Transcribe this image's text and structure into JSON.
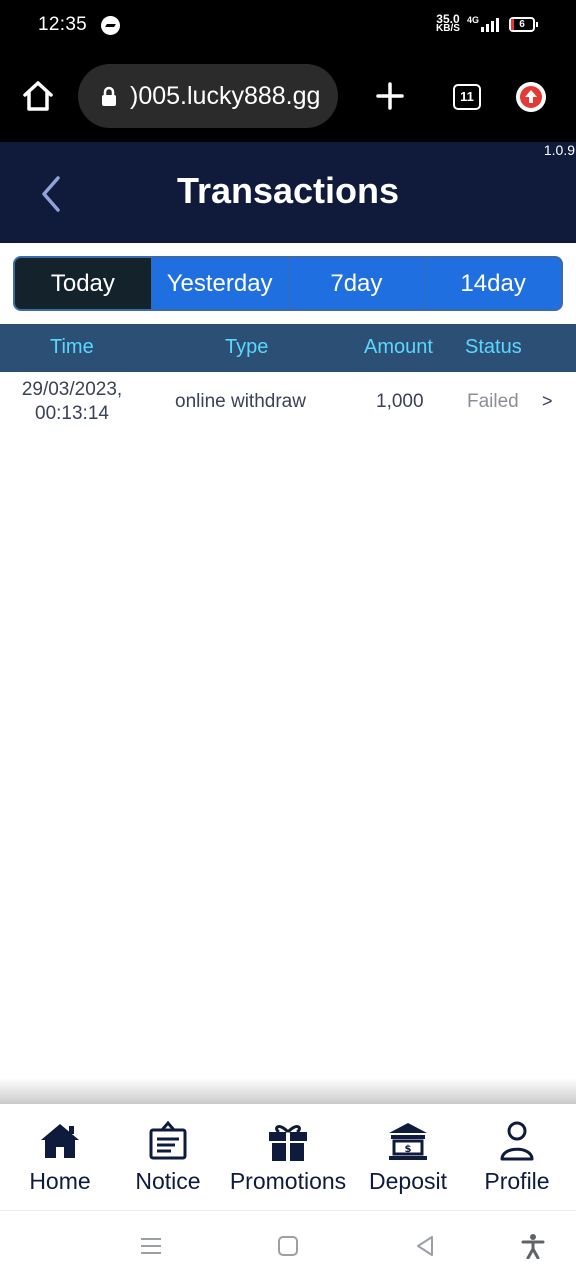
{
  "status_bar": {
    "time": "12:35",
    "net_speed_value": "35.0",
    "net_speed_unit": "KB/S",
    "network": "4G",
    "battery": "6",
    "icons": [
      "messenger-icon",
      "signal-icon",
      "battery-icon"
    ]
  },
  "browser": {
    "url": ")005.lucky888.gg",
    "tab_count": "11",
    "icons": [
      "home-icon",
      "lock-icon",
      "plus-icon",
      "tabs-icon",
      "update-icon"
    ]
  },
  "app": {
    "version": "1.0.9",
    "title": "Transactions"
  },
  "tabs": [
    {
      "label": "Today",
      "active": true
    },
    {
      "label": "Yesterday",
      "active": false
    },
    {
      "label": "7day",
      "active": false
    },
    {
      "label": "14day",
      "active": false
    }
  ],
  "table": {
    "columns": [
      "Time",
      "Type",
      "Amount",
      "Status"
    ],
    "rows": [
      {
        "time_date": "29/03/2023,",
        "time_clock": "00:13:14",
        "type": "online withdraw",
        "amount": "1,000",
        "status": "Failed",
        "chevron": ">"
      }
    ]
  },
  "bottom_nav": [
    {
      "label": "Home",
      "icon": "home-icon"
    },
    {
      "label": "Notice",
      "icon": "notice-icon"
    },
    {
      "label": "Promotions",
      "icon": "gift-icon"
    },
    {
      "label": "Deposit",
      "icon": "bank-icon"
    },
    {
      "label": "Profile",
      "icon": "user-icon"
    }
  ],
  "colors": {
    "header_bg": "#101a3b",
    "tab_active_bg": "#13222b",
    "tab_bg": "#1f6fe0",
    "table_header_bg": "#2c4f75",
    "table_header_text": "#5ad7ff",
    "status_failed": "#8b8f95"
  }
}
